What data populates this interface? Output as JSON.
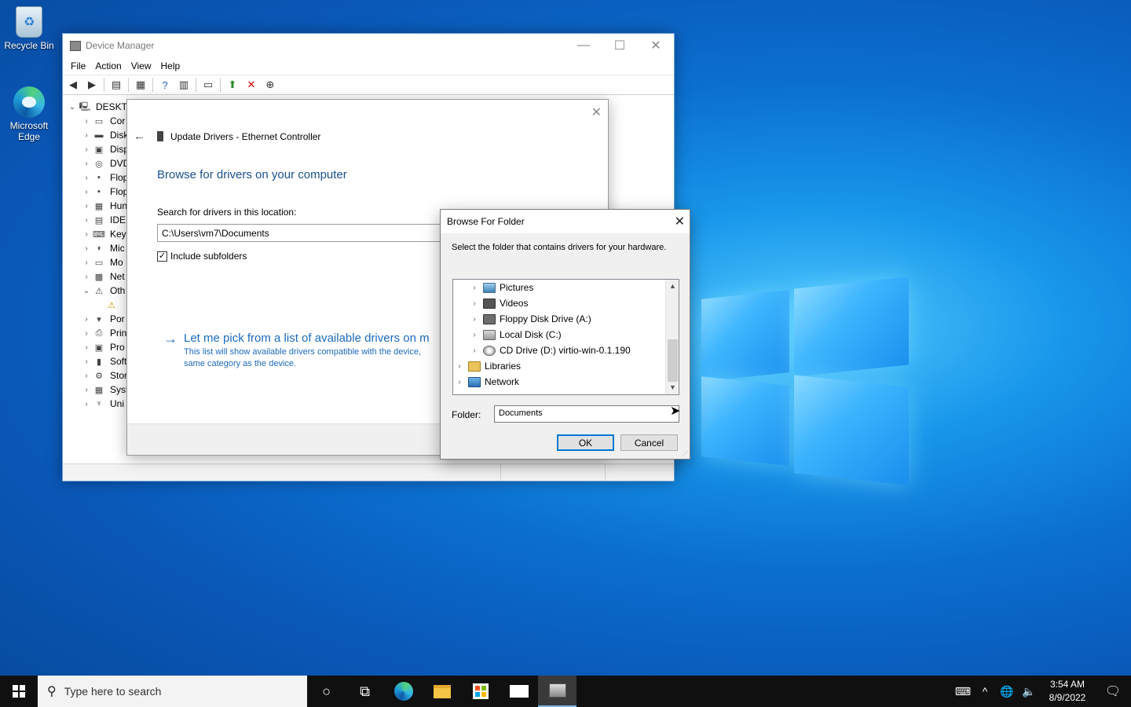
{
  "desktop": {
    "icons": [
      {
        "label": "Recycle Bin"
      },
      {
        "label": "Microsoft Edge"
      }
    ]
  },
  "device_manager": {
    "title": "Device Manager",
    "menu": [
      "File",
      "Action",
      "View",
      "Help"
    ],
    "tree": {
      "root": "DESKTO",
      "items": [
        "Cor",
        "Disk",
        "Disp",
        "DVD",
        "Flop",
        "Flop",
        "Hun",
        "IDE",
        "Key",
        "Mic",
        "Mo",
        "Net",
        "Oth",
        "",
        "Por",
        "Prin",
        "Pro",
        "Soft",
        "Stor",
        "Syst",
        "Uni"
      ]
    }
  },
  "update_drivers": {
    "title": "Update Drivers - Ethernet Controller",
    "heading": "Browse for drivers on your computer",
    "search_label": "Search for drivers in this location:",
    "path_value": "C:\\Users\\vm7\\Documents",
    "include_subfolders_label": "Include subfolders",
    "include_subfolders_checked": true,
    "pick_title": "Let me pick from a list of available drivers on m",
    "pick_desc_1": "This list will show available drivers compatible with the device,",
    "pick_desc_2": "same category as the device."
  },
  "browse_folder": {
    "title": "Browse For Folder",
    "instruction": "Select the folder that contains drivers for your hardware.",
    "tree": [
      {
        "label": "Pictures",
        "icon": "pictures-icon"
      },
      {
        "label": "Videos",
        "icon": "videos-icon"
      },
      {
        "label": "Floppy Disk Drive (A:)",
        "icon": "floppy-icon"
      },
      {
        "label": "Local Disk (C:)",
        "icon": "local-disk-icon"
      },
      {
        "label": "CD Drive (D:) virtio-win-0.1.190",
        "icon": "cd-drive-icon"
      },
      {
        "label": "Libraries",
        "icon": "libraries-icon"
      },
      {
        "label": "Network",
        "icon": "network-icon"
      }
    ],
    "folder_label": "Folder:",
    "folder_value": "Documents",
    "ok_label": "OK",
    "cancel_label": "Cancel"
  },
  "taskbar": {
    "search_placeholder": "Type here to search",
    "time": "3:54 AM",
    "date": "8/9/2022"
  }
}
